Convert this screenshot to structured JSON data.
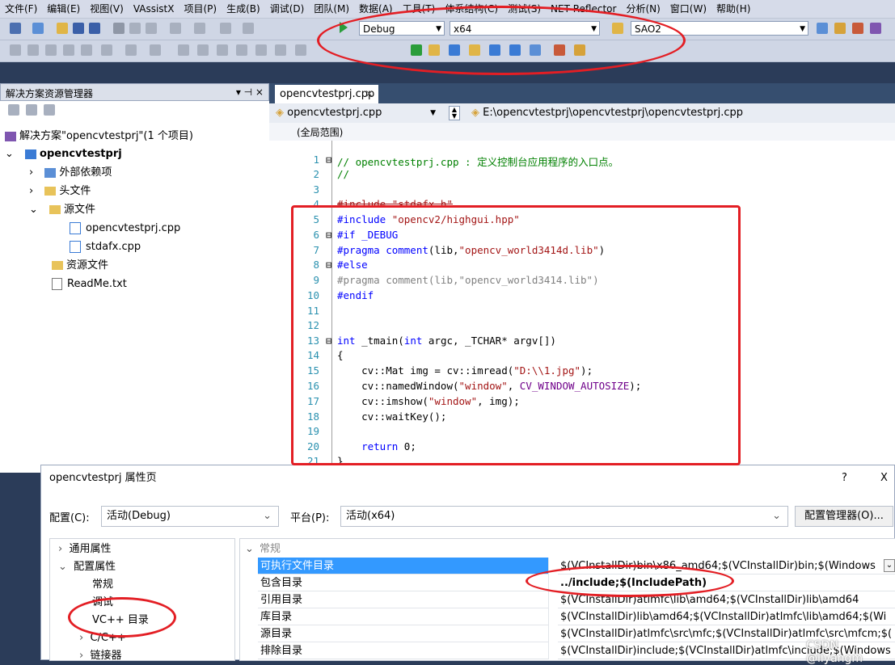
{
  "menu": [
    "文件(F)",
    "编辑(E)",
    "视图(V)",
    "VAssistX",
    "项目(P)",
    "生成(B)",
    "调试(D)",
    "团队(M)",
    "数据(A)",
    "工具(T)",
    "体系结构(C)",
    "测试(S)",
    "NET Reflector",
    "分析(N)",
    "窗口(W)",
    "帮助(H)"
  ],
  "toolbar": {
    "config_value": "Debug",
    "platform_value": "x64",
    "find_value": "SAO2"
  },
  "solution_explorer": {
    "title": "解决方案资源管理器",
    "pin": "▾ ⊣ ×",
    "solution_label": "解决方案\"opencvtestprj\"(1 个项目)",
    "project_label": "opencvtestprj",
    "items": [
      "外部依赖项",
      "头文件",
      "源文件",
      "opencvtestprj.cpp",
      "stdafx.cpp",
      "资源文件",
      "ReadMe.txt"
    ]
  },
  "editor": {
    "tab_label": "opencvtestprj.cpp",
    "nav_left": "opencvtestprj.cpp",
    "nav_right": "E:\\opencvtestprj\\opencvtestprj\\opencvtestprj.cpp",
    "scope": "(全局范围)",
    "line_numbers": [
      "1",
      "2",
      "3",
      "4",
      "5",
      "6",
      "7",
      "8",
      "9",
      "10",
      "11",
      "12",
      "13",
      "14",
      "15",
      "16",
      "17",
      "18",
      "19",
      "20",
      "21"
    ]
  },
  "code": {
    "l1": "// opencvtestprj.cpp : 定义控制台应用程序的入口点。",
    "l2": "//",
    "l4": "#include \"stdafx.h\"",
    "l5a": "#include ",
    "l5b": "\"opencv2/highgui.hpp\"",
    "l6": "#if _DEBUG",
    "l7a": "#pragma comment",
    "l7b": "(lib,",
    "l7c": "\"opencv_world3414d.lib\"",
    "l7d": ")",
    "l8": "#else",
    "l9": "#pragma comment(lib,\"opencv_world3414.lib\")",
    "l10": "#endif",
    "l13a": "int",
    "l13b": " _tmain(",
    "l13c": "int",
    "l13d": " argc, _TCHAR* argv[])",
    "l14": "{",
    "l15a": "    cv::Mat img = cv::imread(",
    "l15b": "\"D:\\\\1.jpg\"",
    "l15c": ");",
    "l16a": "    cv::namedWindow(",
    "l16b": "\"window\"",
    "l16c": ", ",
    "l16d": "CV_WINDOW_AUTOSIZE",
    "l16e": ");",
    "l17a": "    cv::imshow(",
    "l17b": "\"window\"",
    "l17c": ", img);",
    "l18": "    cv::waitKey();",
    "l20a": "    ",
    "l20b": "return",
    "l20c": " 0;",
    "l21": "}"
  },
  "dialog": {
    "title": "opencvtestprj 属性页",
    "help": "?",
    "close": "X",
    "config_label": "配置(C):",
    "config_value": "活动(Debug)",
    "platform_label": "平台(P):",
    "platform_value": "活动(x64)",
    "config_manager": "配置管理器(O)...",
    "tree": [
      "通用属性",
      "配置属性",
      "常规",
      "调试",
      "VC++ 目录",
      "C/C++",
      "链接器"
    ],
    "section": "常规",
    "props": [
      {
        "name": "可执行文件目录",
        "value": "$(VCInstallDir)bin\\x86_amd64;$(VCInstallDir)bin;$(Windows"
      },
      {
        "name": "包含目录",
        "value": "../include;$(IncludePath)"
      },
      {
        "name": "引用目录",
        "value": "$(VCInstallDir)atlmfc\\lib\\amd64;$(VCInstallDir)lib\\amd64"
      },
      {
        "name": "库目录",
        "value": "$(VCInstallDir)lib\\amd64;$(VCInstallDir)atlmfc\\lib\\amd64;$(Wi"
      },
      {
        "name": "源目录",
        "value": "$(VCInstallDir)atlmfc\\src\\mfc;$(VCInstallDir)atlmfc\\src\\mfcm;$("
      },
      {
        "name": "排除目录",
        "value": "$(VCInstallDir)include;$(VCInstallDir)atlmfc\\include;$(Windows"
      }
    ],
    "watermark": "CSDN @liyangm"
  },
  "colors": {
    "annotation": "#e31e24",
    "selection": "#3399ff"
  }
}
